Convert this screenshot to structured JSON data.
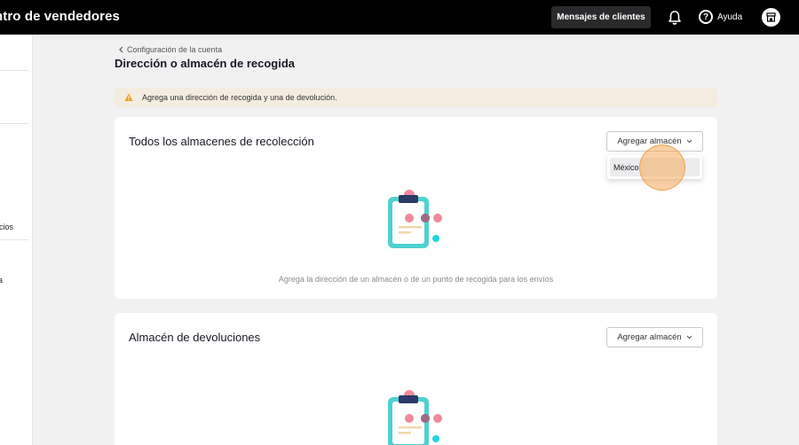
{
  "topbar": {
    "brand": "ntro de vendedores",
    "messages_button": "Mensajes de clientes",
    "help_label": "Ayuda",
    "icons": [
      "bell-icon",
      "help-icon",
      "shop-icon"
    ]
  },
  "sidebar": {
    "items": [
      "icios",
      "a"
    ]
  },
  "header": {
    "breadcrumb": "Configuración de la cuenta",
    "title": "Dirección o almacén de recogida"
  },
  "banner": {
    "text": "Agrega una dirección de recogida y una de devolución."
  },
  "pickup": {
    "title": "Todos los almacenes de recolección",
    "add_button": "Agregar almacén",
    "dropdown_options": [
      "México"
    ],
    "empty_text": "Agrega la dirección de un almacén o de un punto de recogida para los envíos"
  },
  "returns": {
    "title": "Almacén de devoluciones",
    "add_button": "Agregar almacén"
  },
  "colors": {
    "topbar": "#000000",
    "banner": "#f4ecdf",
    "warning": "#e8a21a",
    "teal": "#4fd1d1",
    "pink": "#f08a9a"
  }
}
